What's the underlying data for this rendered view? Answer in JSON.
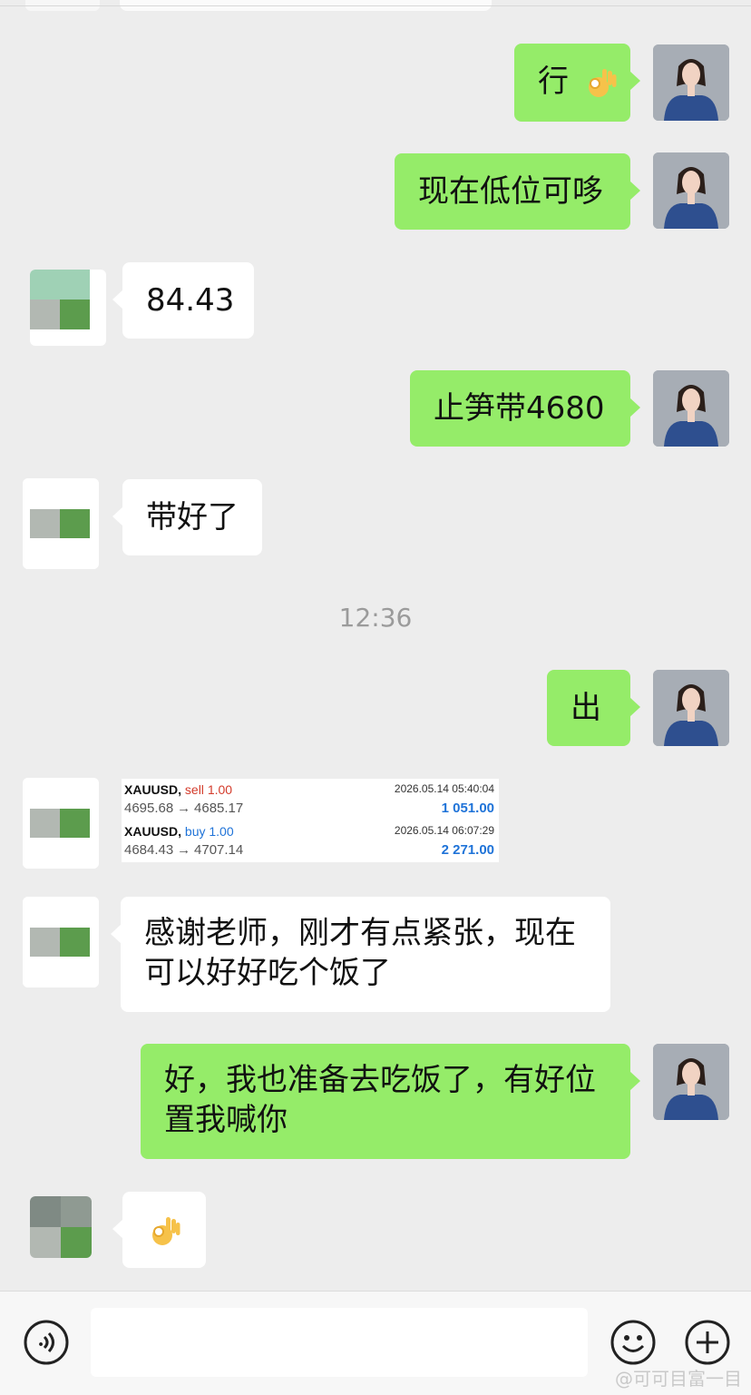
{
  "colors": {
    "background": "#ededed",
    "outgoing_bubble": "#95ec69",
    "incoming_bubble": "#ffffff",
    "timestamp_text": "#9b9b9b",
    "sell": "#d33b2b",
    "buy": "#1f73d8"
  },
  "messages": {
    "m1": {
      "side": "outgoing",
      "text": "行",
      "emoji": "ok-hand-icon"
    },
    "m2": {
      "side": "outgoing",
      "text": "现在低位可哆"
    },
    "m3": {
      "side": "incoming",
      "text": "84.43"
    },
    "m4": {
      "side": "outgoing",
      "text": "止笋带4680"
    },
    "m5": {
      "side": "incoming",
      "text": "带好了"
    },
    "m6": {
      "side": "outgoing",
      "text": "出"
    },
    "m7": {
      "side": "incoming",
      "text": "感谢老师，刚才有点紧张，现在可以好好吃个饭了"
    },
    "m8": {
      "side": "outgoing",
      "text": "好，我也准备去吃饭了，有好位置我喊你"
    },
    "m9": {
      "side": "incoming",
      "emoji": "ok-hand-icon"
    }
  },
  "timestamp": "12:36",
  "trades": [
    {
      "symbol": "XAUUSD,",
      "action": "sell",
      "lots": "1.00",
      "datetime": "2026.05.14 05:40:04",
      "open": "4695.68",
      "close": "4685.17",
      "profit": "1 051.00"
    },
    {
      "symbol": "XAUUSD,",
      "action": "buy",
      "lots": "1.00",
      "datetime": "2026.05.14 06:07:29",
      "open": "4684.43",
      "close": "4707.14",
      "profit": "2 271.00"
    }
  ],
  "arrow": "→",
  "input_bar": {
    "voice_icon": "voice-icon",
    "emoji_icon": "emoji-icon",
    "plus_icon": "plus-icon"
  },
  "watermark": "@可可目富一目"
}
